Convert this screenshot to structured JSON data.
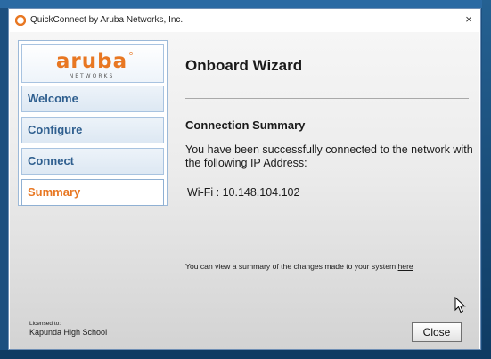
{
  "window": {
    "title": "QuickConnect by Aruba Networks, Inc.",
    "close_glyph": "×"
  },
  "logo": {
    "brand": "aruba",
    "tagline": "NETWORKS"
  },
  "nav": {
    "items": [
      {
        "label": "Welcome",
        "active": false
      },
      {
        "label": "Configure",
        "active": false
      },
      {
        "label": "Connect",
        "active": false
      },
      {
        "label": "Summary",
        "active": true
      }
    ]
  },
  "main": {
    "title": "Onboard Wizard",
    "section_title": "Connection Summary",
    "message": "You have been successfully connected to the network with the following IP Address:",
    "ip_line": "Wi-Fi : 10.148.104.102",
    "summary_text": "You can view a summary of the changes made to your system ",
    "summary_link": "here"
  },
  "footer": {
    "licensed_label": "Licensed to:",
    "licensed_name": "Kapunda High School",
    "close_label": "Close"
  },
  "colors": {
    "brand_orange": "#e87722",
    "nav_blue": "#2f5f8f",
    "desktop_blue": "#1c4f7f"
  },
  "icons": {
    "app": "aruba-logo-icon",
    "close": "close-icon",
    "cursor": "mouse-pointer-icon"
  }
}
